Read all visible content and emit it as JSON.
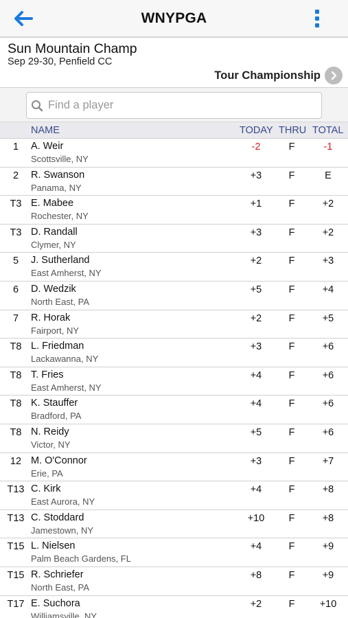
{
  "nav": {
    "title": "WNYPGA"
  },
  "event": {
    "name": "Sun Mountain Champ",
    "meta": "Sep 29-30, Penfield CC",
    "round_label": "Tour Championship"
  },
  "search": {
    "placeholder": "Find a player"
  },
  "table": {
    "headers": {
      "name": "NAME",
      "today": "TODAY",
      "thru": "THRU",
      "total": "TOTAL"
    },
    "rows": [
      {
        "pos": "1",
        "name": "A. Weir",
        "location": "Scottsville, NY",
        "today": "-2",
        "thru": "F",
        "total": "-1"
      },
      {
        "pos": "2",
        "name": "R. Swanson",
        "location": "Panama, NY",
        "today": "+3",
        "thru": "F",
        "total": "E"
      },
      {
        "pos": "T3",
        "name": "E. Mabee",
        "location": "Rochester, NY",
        "today": "+1",
        "thru": "F",
        "total": "+2"
      },
      {
        "pos": "T3",
        "name": "D. Randall",
        "location": "Clymer, NY",
        "today": "+3",
        "thru": "F",
        "total": "+2"
      },
      {
        "pos": "5",
        "name": "J. Sutherland",
        "location": "East Amherst, NY",
        "today": "+2",
        "thru": "F",
        "total": "+3"
      },
      {
        "pos": "6",
        "name": "D. Wedzik",
        "location": "North East, PA",
        "today": "+5",
        "thru": "F",
        "total": "+4"
      },
      {
        "pos": "7",
        "name": "R. Horak",
        "location": "Fairport, NY",
        "today": "+2",
        "thru": "F",
        "total": "+5"
      },
      {
        "pos": "T8",
        "name": "L. Friedman",
        "location": "Lackawanna, NY",
        "today": "+3",
        "thru": "F",
        "total": "+6"
      },
      {
        "pos": "T8",
        "name": "T. Fries",
        "location": "East Amherst, NY",
        "today": "+4",
        "thru": "F",
        "total": "+6"
      },
      {
        "pos": "T8",
        "name": "K. Stauffer",
        "location": "Bradford, PA",
        "today": "+4",
        "thru": "F",
        "total": "+6"
      },
      {
        "pos": "T8",
        "name": "N. Reidy",
        "location": "Victor, NY",
        "today": "+5",
        "thru": "F",
        "total": "+6"
      },
      {
        "pos": "12",
        "name": "M. O'Connor",
        "location": "Erie, PA",
        "today": "+3",
        "thru": "F",
        "total": "+7"
      },
      {
        "pos": "T13",
        "name": "C. Kirk",
        "location": "East Aurora, NY",
        "today": "+4",
        "thru": "F",
        "total": "+8"
      },
      {
        "pos": "T13",
        "name": "C. Stoddard",
        "location": "Jamestown, NY",
        "today": "+10",
        "thru": "F",
        "total": "+8"
      },
      {
        "pos": "T15",
        "name": "L. Nielsen",
        "location": "Palm Beach Gardens, FL",
        "today": "+4",
        "thru": "F",
        "total": "+9"
      },
      {
        "pos": "T15",
        "name": "R. Schriefer",
        "location": "North East, PA",
        "today": "+8",
        "thru": "F",
        "total": "+9"
      },
      {
        "pos": "T17",
        "name": "E. Suchora",
        "location": "Williamsville, NY",
        "today": "+2",
        "thru": "F",
        "total": "+10"
      }
    ]
  },
  "colors": {
    "accent": "#1a7bdc",
    "header_text": "#3a4a8c",
    "under_par": "#d62020"
  },
  "icons": {
    "back": "arrow-left-icon",
    "menu": "vertical-dots-icon",
    "round": "chevron-right-icon",
    "search": "search-icon"
  }
}
